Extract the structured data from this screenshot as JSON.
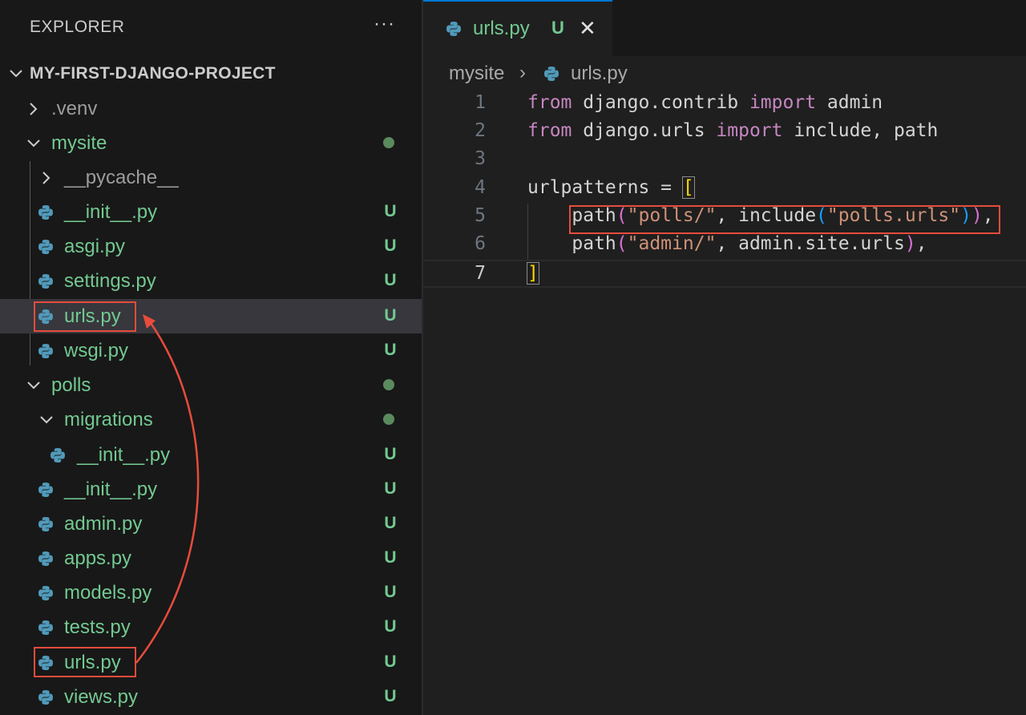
{
  "sidebar": {
    "title": "EXPLORER",
    "more_label": "···",
    "project": "MY-FIRST-DJANGO-PROJECT",
    "items": [
      {
        "label": ".venv",
        "type": "folder",
        "expanded": false,
        "status": ""
      },
      {
        "label": "mysite",
        "type": "folder",
        "expanded": true,
        "status": "dot"
      },
      {
        "label": "__pycache__",
        "type": "folder",
        "expanded": false,
        "status": ""
      },
      {
        "label": "__init__.py",
        "type": "python-file",
        "status": "U"
      },
      {
        "label": "asgi.py",
        "type": "python-file",
        "status": "U"
      },
      {
        "label": "settings.py",
        "type": "python-file",
        "status": "U"
      },
      {
        "label": "urls.py",
        "type": "python-file",
        "status": "U",
        "selected": true
      },
      {
        "label": "wsgi.py",
        "type": "python-file",
        "status": "U"
      },
      {
        "label": "polls",
        "type": "folder",
        "expanded": true,
        "status": "dot"
      },
      {
        "label": "migrations",
        "type": "folder",
        "expanded": true,
        "status": "dot"
      },
      {
        "label": "__init__.py",
        "type": "python-file",
        "status": "U"
      },
      {
        "label": "__init__.py",
        "type": "python-file",
        "status": "U"
      },
      {
        "label": "admin.py",
        "type": "python-file",
        "status": "U"
      },
      {
        "label": "apps.py",
        "type": "python-file",
        "status": "U"
      },
      {
        "label": "models.py",
        "type": "python-file",
        "status": "U"
      },
      {
        "label": "tests.py",
        "type": "python-file",
        "status": "U"
      },
      {
        "label": "urls.py",
        "type": "python-file",
        "status": "U"
      },
      {
        "label": "views.py",
        "type": "python-file",
        "status": "U"
      }
    ]
  },
  "editor": {
    "tab": {
      "label": "urls.py",
      "status": "U",
      "close": "✕"
    },
    "breadcrumb": {
      "folder": "mysite",
      "separator": "›",
      "file": "urls.py"
    },
    "line_numbers": [
      "1",
      "2",
      "3",
      "4",
      "5",
      "6",
      "7"
    ],
    "lines": {
      "l1": {
        "kw1": "from",
        "t1": " django.contrib ",
        "kw2": "import",
        "t2": " admin"
      },
      "l2": {
        "kw1": "from",
        "t1": " django.urls ",
        "kw2": "import",
        "t2": " include, path"
      },
      "l4": {
        "t1": "urlpatterns = ",
        "b1": "["
      },
      "l5": {
        "indent": "    ",
        "t1": "path",
        "p1": "(",
        "s1": "\"polls/\"",
        "t2": ", include",
        "p2": "(",
        "s2": "\"polls.urls\"",
        "p3": ")",
        "p4": ")",
        "t3": ","
      },
      "l6": {
        "indent": "    ",
        "t1": "path",
        "p1": "(",
        "s1": "\"admin/\"",
        "t2": ", admin.site.urls",
        "p2": ")",
        "t3": ","
      },
      "l7": {
        "b1": "]"
      }
    }
  },
  "annotations": {
    "highlight_color": "#e74c3c"
  },
  "colors": {
    "sidebar_bg": "#181818",
    "editor_bg": "#1f1f1f",
    "untracked_green": "#73c991",
    "keyword": "#c586c0",
    "string": "#ce9178",
    "accent_tab": "#0078d4"
  }
}
